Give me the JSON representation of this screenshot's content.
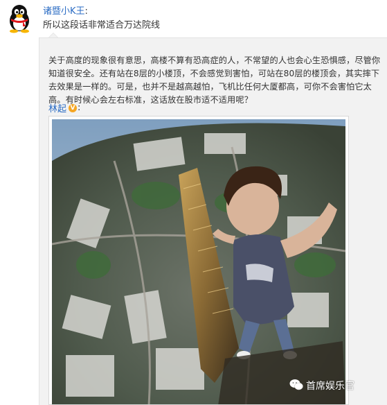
{
  "post": {
    "author": "诸暨小K王",
    "author_colon": ":",
    "text": "所以这段话非常适合万达院线"
  },
  "quote": {
    "text": "关于高度的现象很有意思，高楼不算有恐高症的人，不常望的人也会心生恐惧感，尽管你知道很安全。还有站在8层的小楼顶，不会感觉到害怕，可站在80层的楼顶会，其实摔下去效果是一样的。可是，也并不是越高越怕，飞机比任何大厦都高，可你不会害怕它太高。有时候心会左右标准，这话放在股市适不适用呢？",
    "author": "林起",
    "verified_badge": "V",
    "author_colon": ":"
  },
  "watermark": {
    "text": "首席娱乐官"
  },
  "colors": {
    "link": "#2b6cc4",
    "quote_bg": "#f2f2f2",
    "badge": "#f5a623"
  }
}
